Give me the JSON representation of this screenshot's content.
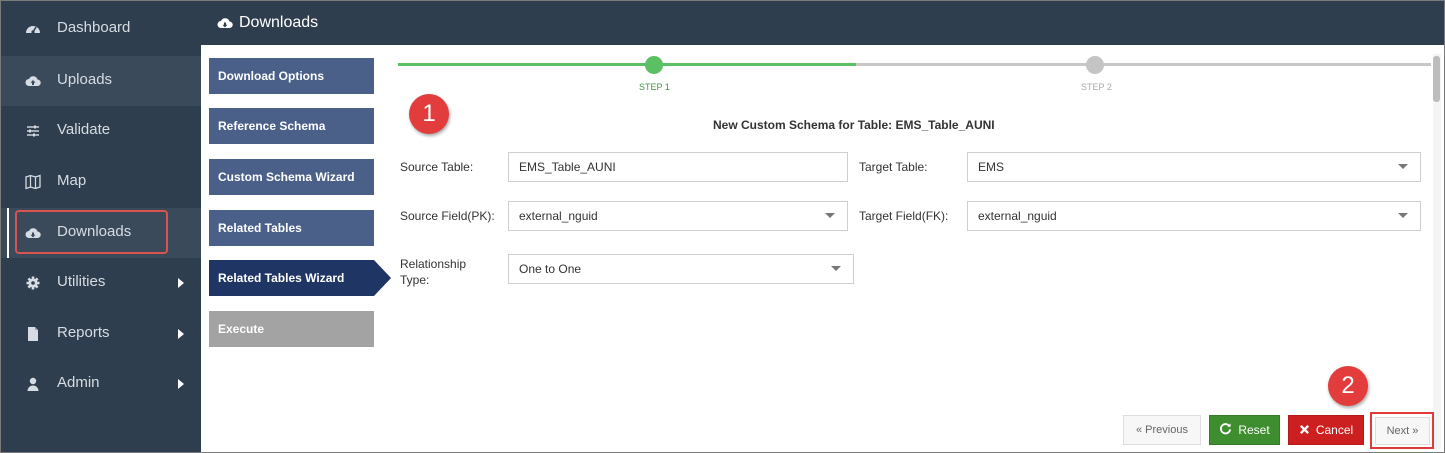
{
  "sidebar": {
    "items": [
      {
        "label": "Dashboard",
        "icon": "dashboard-icon"
      },
      {
        "label": "Uploads",
        "icon": "cloud-upload-icon"
      },
      {
        "label": "Validate",
        "icon": "sliders-icon"
      },
      {
        "label": "Map",
        "icon": "map-icon"
      },
      {
        "label": "Downloads",
        "icon": "cloud-download-icon",
        "active": true
      },
      {
        "label": "Utilities",
        "icon": "gear-icon",
        "has_submenu": true
      },
      {
        "label": "Reports",
        "icon": "document-icon",
        "has_submenu": true
      },
      {
        "label": "Admin",
        "icon": "user-icon",
        "has_submenu": true
      }
    ]
  },
  "header": {
    "title": "Downloads",
    "icon": "cloud-download-icon"
  },
  "wizard_steps": [
    {
      "label": "Download Options",
      "state": "done"
    },
    {
      "label": "Reference Schema",
      "state": "done"
    },
    {
      "label": "Custom Schema Wizard",
      "state": "done"
    },
    {
      "label": "Related Tables",
      "state": "done"
    },
    {
      "label": "Related Tables Wizard",
      "state": "active"
    },
    {
      "label": "Execute",
      "state": "disabled"
    }
  ],
  "progress": {
    "step1_label": "STEP 1",
    "step2_label": "STEP 2",
    "current_step": 1,
    "total_steps": 2
  },
  "annotations": {
    "one": "1",
    "two": "2"
  },
  "form": {
    "title": "New Custom Schema for Table: EMS_Table_AUNI",
    "source_table_label": "Source Table:",
    "source_table_value": "EMS_Table_AUNI",
    "target_table_label": "Target Table:",
    "target_table_value": "EMS",
    "source_field_label": "Source Field(PK):",
    "source_field_value": "external_nguid",
    "target_field_label": "Target Field(FK):",
    "target_field_value": "external_nguid",
    "relationship_label_line1": "Relationship",
    "relationship_label_line2": "Type:",
    "relationship_value": "One to One"
  },
  "buttons": {
    "previous": "« Previous",
    "reset": "Reset",
    "cancel": "Cancel",
    "next": "Next »"
  },
  "colors": {
    "sidebar_bg": "#2f3e4e",
    "step_done": "#4a6088",
    "step_active": "#1f3563",
    "step_disabled": "#a3a3a3",
    "progress_green": "#5bc064",
    "reset_green": "#3e8e2f",
    "cancel_red": "#cc1f1f",
    "annotation_red": "#e23c3c"
  }
}
